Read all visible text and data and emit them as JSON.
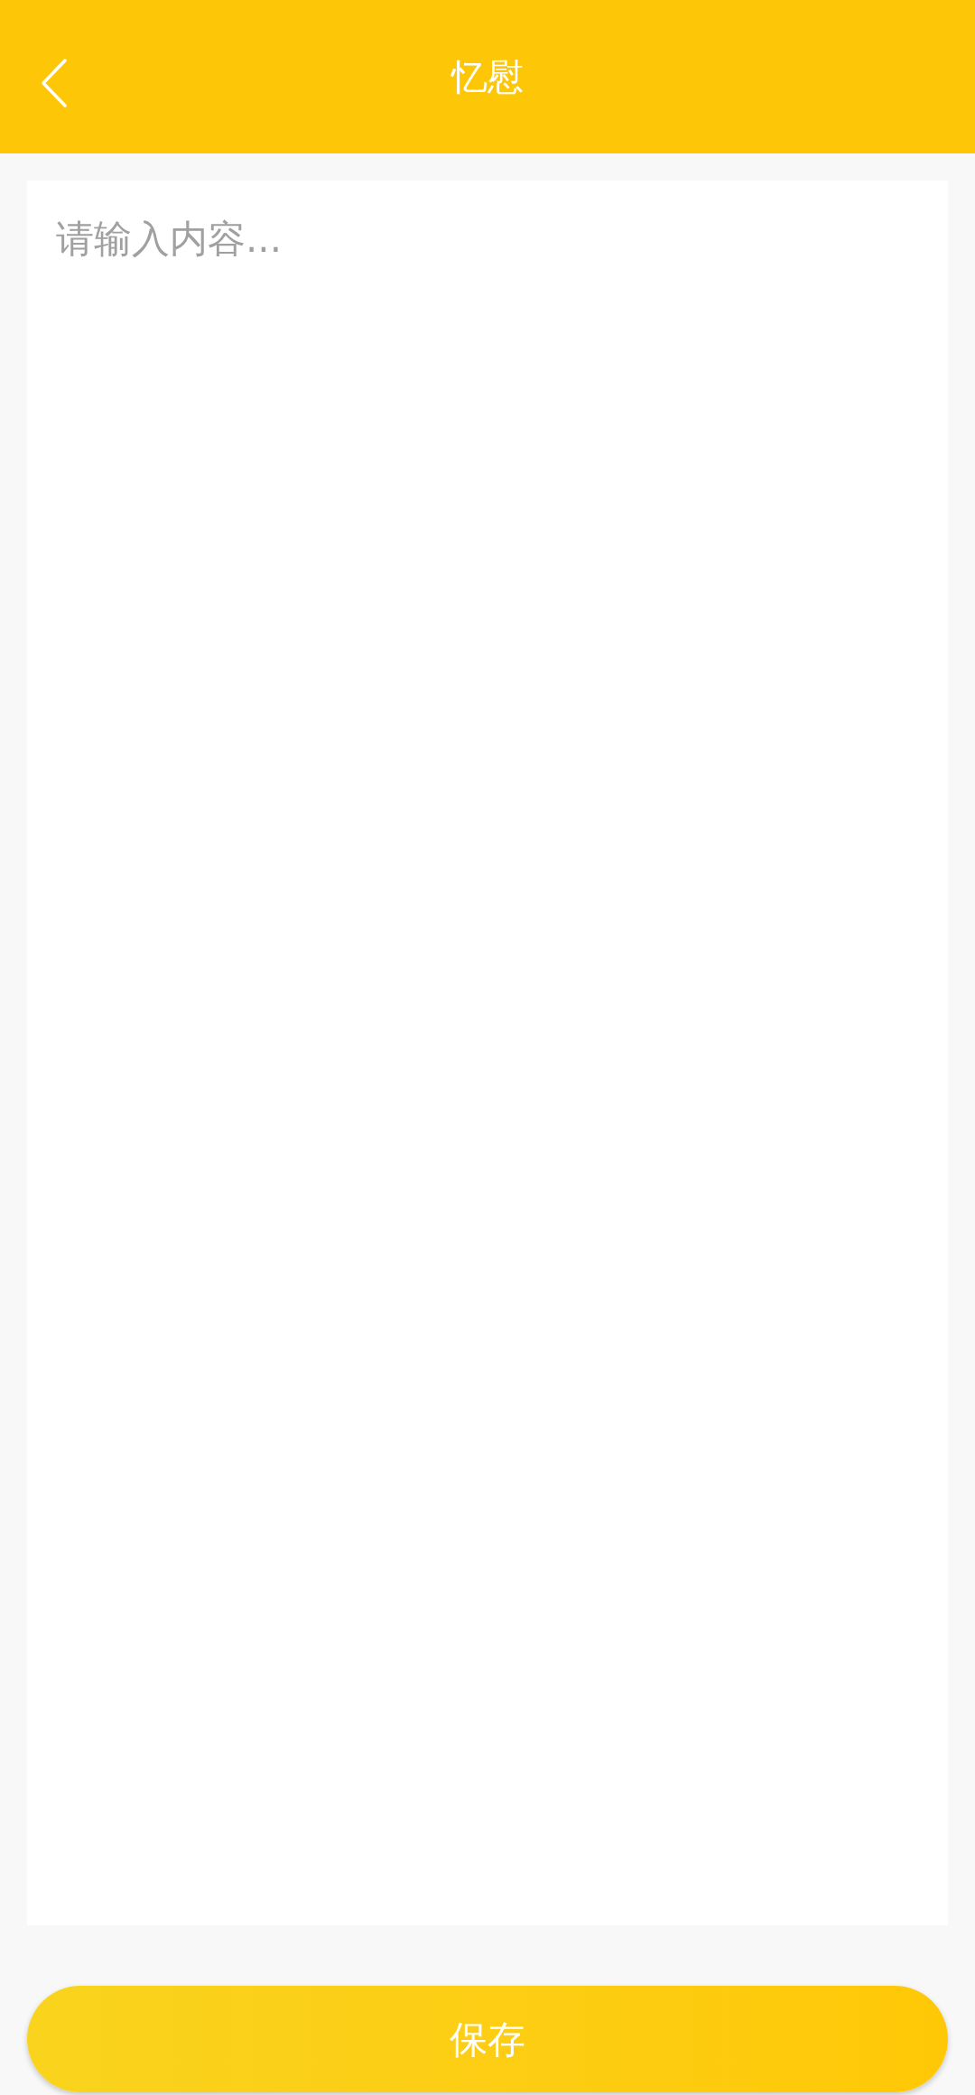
{
  "header": {
    "title": "忆慰"
  },
  "editor": {
    "placeholder": "请输入内容..."
  },
  "save_button": {
    "label": "保存"
  }
}
